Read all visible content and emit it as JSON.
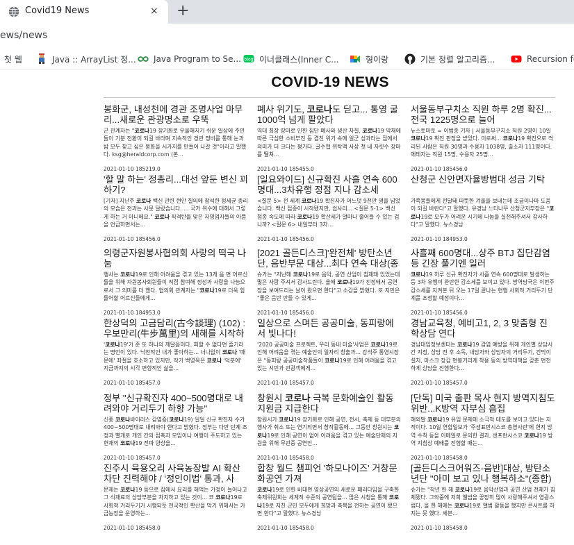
{
  "browser": {
    "tab_title": "Covid19 News",
    "tab_close": "×",
    "new_tab": "+",
    "url": "ews/news",
    "bookmarks": [
      {
        "label": "첫 웹",
        "icon": "web-icon",
        "color": "#777777"
      },
      {
        "label": "Java :: ArrayList 정...",
        "icon": "person-icon",
        "color": "#3b6fb6"
      },
      {
        "label": "Java Program to Se...",
        "icon": "geeks-icon",
        "color": "#2f8d46"
      },
      {
        "label": "이너클래스(Inner C...",
        "icon": "blog-icon",
        "color": "#03c75a"
      },
      {
        "label": "형이랑",
        "icon": "meet-icon",
        "color": "#00897b"
      },
      {
        "label": "기본 정렬 알고리즘...",
        "icon": "github-icon",
        "color": "#222222"
      },
      {
        "label": "Recursion for",
        "icon": "youtube-icon",
        "color": "#ff0000"
      }
    ]
  },
  "page": {
    "title": "COVID-19 NEWS"
  },
  "columns": [
    [
      {
        "title": "봉화군, 내성천에 경관 조명사업 마무리...새로운 관광명소로 우뚝",
        "body": "군 관계자는 \"<b>코로나</b>19 장기화로 우울해지기 쉬운 일상에 주민들이 기분 전환이 되길 바라며 지속적인 경관 정비를 통해 눈과 밤 모두 찾고 싶은 봉화을 시가지를 만들어 나갈 것\"이라고 말했다. ksg@heraldcorp.com (본...",
        "date": "2021-01-10 185219.0"
      },
      {
        "title": "'할 말 하는' 정총리...대선 앞둔 변신 꾀하기?",
        "body": "[기자] 지난주 <b>코로나</b> 백신 관련 현안 질의에 참석한 정세균 총리의 모습은 전과는 사뭇 달랐습니다. ... 국가 위수에 대해서 그렇게 하는 거 아니에요.\" <b>코로나</b> 직격탄을 맞은 자영업자들의 아픔을 언급하면서는...",
        "date": "2021-01-10 185456.0"
      },
      {
        "title": "의령군자원봉사협의회 사랑의 떡국 나눔",
        "body": "행사는 <b>코로나</b>19로 인해 어려움을 겪고 있는 13개 읍 면 어르신들을 위해 자원봉사회원들이 직접 참여해 정성과 사랑을 나눔으로서 그 의미를 더 했다. 협의회 관계자는 \"<b>코로나</b>19로 더욱 힘들어할 어르신들에게...",
        "date": "2021-01-10 184953.0"
      },
      {
        "title": "한상덕의 고금담리(古今談理) (102) : 우보만리(牛步萬里)의 새해를 시작하며",
        "body": "'<b>코로나</b>19'가 준 또 하나의 깨달음이다. 피할 수 없다면 즐기라는 명언이 있다. 낙천적인 내가 좋아하는... 너나없이 <b>코로나</b> '때문에' 좌절을 호소하고 있지만, 작가 백영옥은 <b>코로나</b> '덕분에' 지금까지의 시각 편향적인 삶을...",
        "date": "2021-01-10 185457.0"
      },
      {
        "title": "정부 \"신규확진자 400~500명대로 내려와야 거리두기 하향 가능\"",
        "body": "신풍 <b>코로나</b>바이러스 감염증(<b>코로나</b>19) 일일 신규 확진자 수가 400~500명대로 내려와야 한다고 밝혔다. 정부는 다만 단계 조정과 별개로 개인 간의 접촉과 모임이나 여행이 주도하고 있는 현재의 <b>코로나</b>19 전파 양상을...",
        "date": "2021-01-10 185457.0"
      },
      {
        "title": "진주시 육용오리 사육농장발 AI 확산차단 진력해야 / '정인이법' 통과, 사후...",
        "body": "문제는 <b>코로나</b>19 등으로 집에서 요리를 해먹는 가정이 늘어나고 그 식재료의 상당부분을 차지하고 있는 것이... 코 <b>코로나</b>19로 사회적 거리두기가 시행되듯 전국적인 확산을 막기 위해서는 가금농장을 운영하는...",
        "date": "2021-01-10 185458.0"
      }
    ],
    [
      {
        "title": "폐사 위기도, <b>코로나</b>도 딛고... 통영 굴 1000억 넘게 팔았다",
        "body": "역대 최장 장마로 인한 집단 폐사와 생산 차질, <b>코로나</b>19 악재에 따른 극심한 소비부진 등 겹친 위기 속에 일군 성과라는 점에서 의미가 더 크다는 평가다. 굴수협 위탁액 사상 첫 네 자릿수 장마를 떨쳐...",
        "date": "2021-01-10 185455.0"
      },
      {
        "title": "[일요와이드] 신규확진 사흘 연속 600명대...3차유행 정점 지나 감소세",
        "body": "<질문 5> 전 세계 <b>코로나</b>19 확진자가 어느덧 9천만 명을 넘었습니다. 백신 접종이 시작됐지만, 쉽사리... <질문 5-1> 백신 접종 속도에 따라 <b>코로나</b>19 확산세가 얼마나 줄어들 수 있는 겁니까? <질문 6> 내일부터 3차...",
        "date": "2021-01-10 185456.0"
      },
      {
        "title": "[2021 골든디스크]'완전체' 방탄소년단, 음반부문 대상...최다 연속 대상(종합...",
        "body": "슈가는 \"지난해 <b>코로나</b>19로 음악, 공연 산업이 침체돼 있었는데 많은 사랑 주셔서 감사드린다. 올해 <b>코로나</b>19가 진정돼서 공연장을 보여드리는 날이 왔으면 한다\"고 소감을 밝혔다. 또 지민은 \"좋은 음반 만들 수 있게...",
        "date": "2021-01-10 185456.0"
      },
      {
        "title": "일상으로 스며든 공공미술, 동피랑에서 빛나다!",
        "body": "'2020 공공미술 프로젝트, 우리 동네 미술'사업은 <b>코로나</b>19로 인해 어려움을 겪는 예술인의 일자리 창출과... 강석주 통영시장은 \"동피랑 공공미술작품들이 <b>코로나</b>19로 인해 어려움을 겪고 있는 시민과 관광객에게...",
        "date": "2021-01-10 185457.0"
      },
      {
        "title": "창원시 <b>코로나</b> 극복 문화예술인 활동지원금 지급한다",
        "body": "창원시가 <b>코로나</b>19 장기화로 인해 공연, 전시, 축제 등 대부분의 행사가 취소 또는 연기되면서 창작활동에... 그동안 창원시는 <b>코로나</b>19로 인해 공연이 없어 어려움을 겪고 있는 예술단체의 지원을 위해 무관중 공연인...",
        "date": "2021-01-10 185458.0"
      },
      {
        "title": "합창 월드 챔피언 '하모나이즈' 거창문화공연 가져",
        "body": "<b>코로나</b>19로 인한 비대면 영상공연의 새로운 패러다임을 구축한 축제위원회는 세계적 수준의 공연팀을... 많은 시청을 통해 <b>코로나</b>19로 지친 군민 모두에게 희망과 축복을 전하는 공연이 됐으면 한다\"고 말했다. 뉴스경남",
        "date": "2021-01-10 185458.0"
      }
    ],
    [
      {
        "title": "서울동부구치소 직원 하루 2명 확진...전국 1225명으로 늘어",
        "body": "뉴스토마토 = 이범종 기자 | 서울동부구치소 직원 2명이 10일 <b>코로나</b>19 확진 판정을 받았다. 이로써... <b>코로나</b>19 확진으로 격리된 사람은 직원 30명과 수용자 1038명, 출소자 111명이다. 에테자는 직원 15명, 수용자 25명...",
        "date": "2021-01-10 185456.0"
      },
      {
        "title": "산청군 신안면자율방범대 성금 기탁",
        "body": "가족봉들에게 전달돼 따뜻한 겨울을 보내는데 조금이나마 도움이 되길 바란다\"고 말했다. 유경남 느티나무 산청군지부장은 \"<b>코로나</b>19로 모두가 어려운 시기에 나눔을 실천해주셔서 감사하다\"고 말했다. 뉴스경남",
        "date": "2021-01-10 184953.0"
      },
      {
        "title": "사흘째 600명대...상주 BTJ 집단감염 등 긴장 풀기엔 일러",
        "body": "<b>코로나</b>19 하루 신규 확진자가 사흘 연속 600명대로 발생하는 등 3차 유행이 완만한 감소세를 보이고 있다. 방역당국은 이번주 감소세를 지켜본 뒤 오는 17일 끝나는 현행 사회적 거리두기 단계를 조정할 예정이다...",
        "date": "2021-01-10 185456.0"
      },
      {
        "title": "경남교육청, 예비고1, 2, 3 맞춤형 진학상담 연다",
        "body": "경남대입정보센터는 <b>코로나</b>19 감염 예방을 위해 개인별 상담시간 지정, 상담 전 후 소독, 내담자와 상담자의 거리두기, 칸막이 설치, 마스크 장갑 면봉거리게 착용 등의 방역대책을 갖춘 면전하게 상담을 진행한다...",
        "date": "2021-01-10 185457.0"
      },
      {
        "title": "[단독] 미국 출판 목사 현지 방역지침도 위반...K방역 자부심 흠집",
        "body": "해외발 <b>코로나</b>19 유입 문제에 소극적 태도를 보이고 있다는 지적이다. 10일 연합일보가 '주생표판시스코 총영사관'에 현지 방역 수칙 등을 이메일로 문의한 결과, 샌프란시스코 <b>코로나</b>19 방역 지침상 예배를 진행할 때는...",
        "date": "2021-01-10 185458.0"
      },
      {
        "title": "[골든디스크어워즈-음반]대상, 방탄소년단 \"아미 보고 있나 행복하소\"(종합)",
        "body": "슈가는 \"작년 한 해 <b>코로나</b>19로 음악산업과 공연 산업 전체가 침체됐다. 그와중에 저희 앨범을 꿍장히 많이 사랑해주셔서 영광스럽다. 올 한 해에는 <b>코로나</b>19로 앨범 활동을 했지만 콘서트를 하지는 못 했다. 세븐...",
        "date": "2021-01-10 185458.0"
      }
    ]
  ]
}
